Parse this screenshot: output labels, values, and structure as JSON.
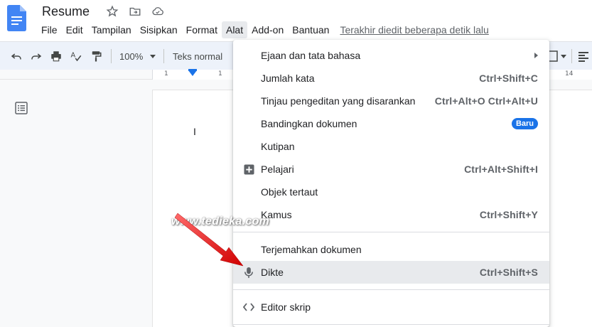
{
  "doc": {
    "title": "Resume"
  },
  "menubar": {
    "items": [
      "File",
      "Edit",
      "Tampilan",
      "Sisipkan",
      "Format",
      "Alat",
      "Add-on",
      "Bantuan"
    ],
    "active": "Alat",
    "last_edit": "Terakhir diedit beberapa detik lalu"
  },
  "toolbar": {
    "zoom": "100%",
    "style": "Teks normal"
  },
  "ruler": {
    "numbers": [
      "1",
      "1",
      "14"
    ]
  },
  "cursor_char": "I",
  "menu": {
    "items": [
      {
        "label": "Ejaan dan tata bahasa",
        "shortcut": "",
        "icon": "",
        "submenu": true
      },
      {
        "label": "Jumlah kata",
        "shortcut": "Ctrl+Shift+C",
        "icon": ""
      },
      {
        "label": "Tinjau pengeditan yang disarankan",
        "shortcut": "Ctrl+Alt+O Ctrl+Alt+U",
        "icon": ""
      },
      {
        "label": "Bandingkan dokumen",
        "shortcut": "",
        "badge": "Baru",
        "icon": ""
      },
      {
        "label": "Kutipan",
        "shortcut": "",
        "icon": ""
      },
      {
        "label": "Pelajari",
        "shortcut": "Ctrl+Alt+Shift+I",
        "icon": "explore-plus-icon"
      },
      {
        "label": "Objek tertaut",
        "shortcut": "",
        "icon": ""
      },
      {
        "label": "Kamus",
        "shortcut": "Ctrl+Shift+Y",
        "icon": ""
      },
      {
        "label": "Terjemahkan dokumen",
        "shortcut": "",
        "icon": ""
      },
      {
        "label": "Dikte",
        "shortcut": "Ctrl+Shift+S",
        "icon": "microphone-icon",
        "highlighted": true
      },
      {
        "label": "Editor skrip",
        "shortcut": "",
        "icon": "code-icon"
      }
    ]
  },
  "watermark": "www.tedieka.com",
  "colors": {
    "brand_blue": "#1a73e8",
    "doc_icon_blue": "#4285f4",
    "arrow_red": "#e31b1b",
    "menu_highlight": "#e8eaed",
    "toolbar_bg": "#edf2fa"
  }
}
